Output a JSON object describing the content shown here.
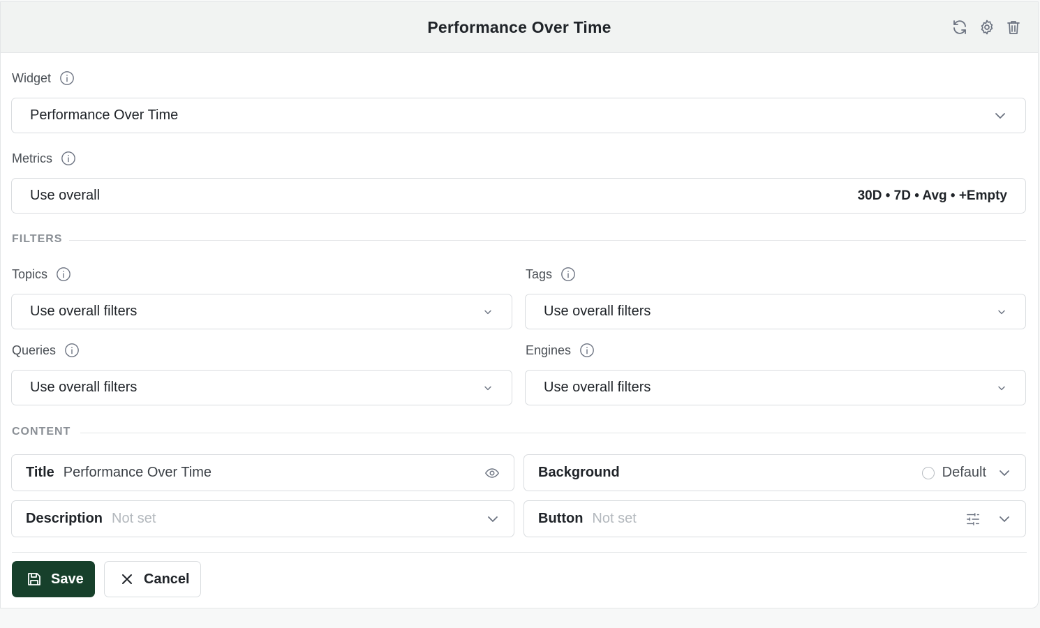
{
  "header": {
    "title": "Performance Over Time",
    "icons": [
      "refresh-icon",
      "gear-icon",
      "trash-icon"
    ]
  },
  "widget": {
    "label": "Widget",
    "value": "Performance Over Time"
  },
  "metrics": {
    "label": "Metrics",
    "value": "Use overall",
    "summary": "30D • 7D • Avg • +Empty"
  },
  "filters": {
    "section_label": "FILTERS",
    "topics": {
      "label": "Topics",
      "value": "Use overall filters"
    },
    "tags": {
      "label": "Tags",
      "value": "Use overall filters"
    },
    "queries": {
      "label": "Queries",
      "value": "Use overall filters"
    },
    "engines": {
      "label": "Engines",
      "value": "Use overall filters"
    }
  },
  "content": {
    "section_label": "CONTENT",
    "title": {
      "label": "Title",
      "value": "Performance Over Time"
    },
    "background": {
      "label": "Background",
      "value": "Default"
    },
    "description": {
      "label": "Description",
      "value": "Not set"
    },
    "button": {
      "label": "Button",
      "value": "Not set"
    }
  },
  "actions": {
    "save_label": "Save",
    "cancel_label": "Cancel"
  },
  "colors": {
    "primary": "#17402b",
    "header_bg": "#f1f3f2",
    "border": "#d9dcdf"
  }
}
